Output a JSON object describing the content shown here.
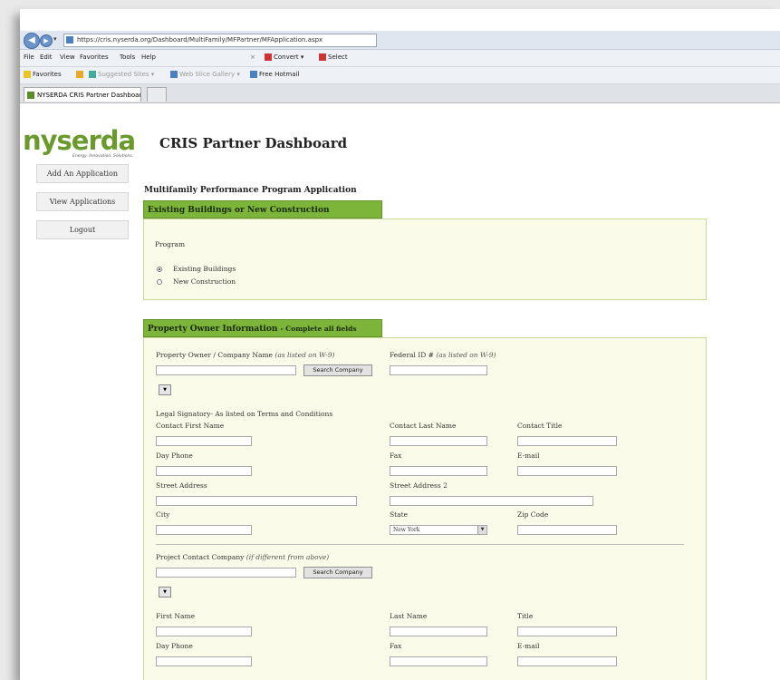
{
  "browser": {
    "url": "https://cris.nyserda.org/Dashboard/MultiFamily/MFPartner/MFApplication.aspx",
    "menu": [
      "File",
      "Edit",
      "View",
      "Favorites",
      "Tools",
      "Help"
    ],
    "toolbar_convert": "Convert",
    "toolbar_select": "Select",
    "favorites": [
      "Favorites",
      "Suggested Sites",
      "Web Slice Gallery",
      "Free Hotmail"
    ],
    "tab_title": "NYSERDA CRIS Partner Dashboard"
  },
  "logo": {
    "text": "nyserda",
    "tagline": "Energy. Innovation. Solutions."
  },
  "dashboard_title": "CRIS Partner Dashboard",
  "sidebar": {
    "items": [
      "Add An Application",
      "View Applications",
      "Logout"
    ]
  },
  "page_heading": "Multifamily Performance Program Application",
  "section1": {
    "header": "Existing Buildings or New Construction",
    "program_label": "Program",
    "options": [
      "Existing Buildings",
      "New Construction"
    ],
    "selected": "Existing Buildings"
  },
  "section2": {
    "header": "Property Owner Information",
    "header_sub": "- Complete all fields",
    "owner_label": "Property Owner / Company Name",
    "owner_note": "(as listed on W-9)",
    "search_button": "Search Company",
    "federal_label": "Federal ID #",
    "federal_note": "(as listed on W-9)",
    "signatory_label": "Legal Signatory- As listed on Terms and Conditions",
    "contact_first": "Contact First Name",
    "contact_last": "Contact Last Name",
    "contact_title": "Contact Title",
    "day_phone": "Day Phone",
    "fax": "Fax",
    "email": "E-mail",
    "street1": "Street Address",
    "street2": "Street Address 2",
    "city": "City",
    "state": "State",
    "state_value": "New York",
    "zip": "Zip Code",
    "project_label": "Project Contact Company",
    "project_note": "(if different from above)",
    "first_name": "First Name",
    "last_name": "Last Name",
    "title": "Title"
  }
}
